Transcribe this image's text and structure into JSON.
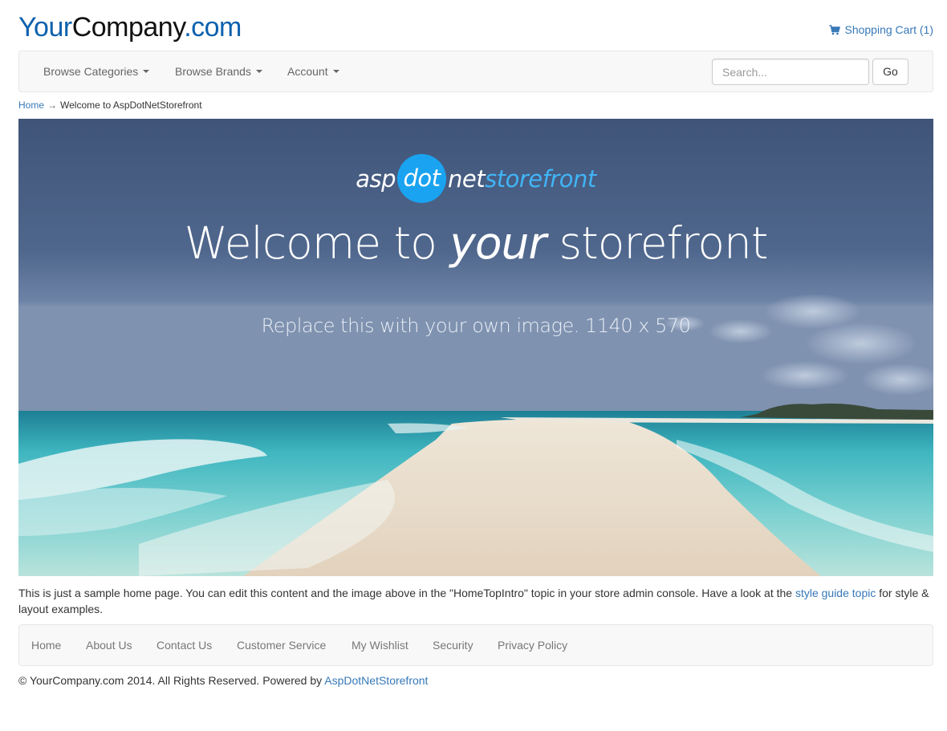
{
  "brand": {
    "name_part1": "Your",
    "name_part2": "Company",
    "name_part3": ".com",
    "color_blue": "#0c61ad"
  },
  "cart": {
    "icon": "shopping-cart-icon",
    "label": "Shopping Cart (1)"
  },
  "navbar": {
    "items": [
      {
        "label": "Browse Categories"
      },
      {
        "label": "Browse Brands"
      },
      {
        "label": "Account"
      }
    ],
    "search": {
      "placeholder": "Search...",
      "value": ""
    },
    "go_label": "Go"
  },
  "breadcrumb": {
    "home": "Home",
    "separator": "→",
    "current": "Welcome to AspDotNetStorefront"
  },
  "hero": {
    "logo": {
      "part1": "asp",
      "part2": "dot",
      "part3": "net",
      "part4": "storefront"
    },
    "title": {
      "before": "Welcome to ",
      "emphasis": "your",
      "after": " storefront"
    },
    "subtitle": "Replace this with your own image. 1140 x 570"
  },
  "intro": {
    "text": "This is just a sample home page. You can edit this content and the image above in the \"HomeTopIntro\" topic in your store admin console. Have a look at the ",
    "link": "style guide topic",
    "tail": " for style & layout examples."
  },
  "footer_nav": {
    "items": [
      {
        "label": "Home"
      },
      {
        "label": "About Us"
      },
      {
        "label": "Contact Us"
      },
      {
        "label": "Customer Service"
      },
      {
        "label": "My Wishlist"
      },
      {
        "label": "Security"
      },
      {
        "label": "Privacy Policy"
      }
    ]
  },
  "copyright": {
    "text": "© YourCompany.com 2014. All Rights Reserved. Powered by ",
    "link": "AspDotNetStorefront"
  },
  "colors": {
    "link": "#3778b8",
    "accent": "#1aa3f0"
  }
}
